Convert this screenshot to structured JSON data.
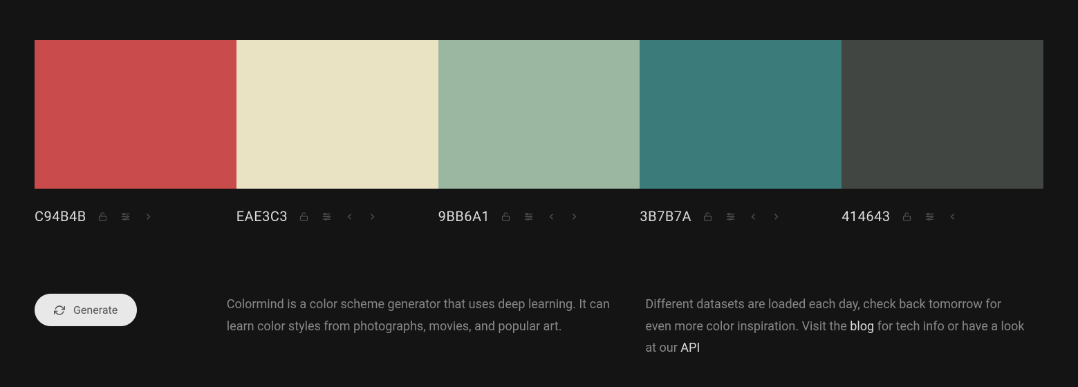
{
  "palette": {
    "swatches": [
      {
        "color": "#C94B4B",
        "hex": "C94B4B",
        "hasLeft": false,
        "hasRight": true
      },
      {
        "color": "#EAE3C3",
        "hex": "EAE3C3",
        "hasLeft": true,
        "hasRight": true
      },
      {
        "color": "#9BB6A1",
        "hex": "9BB6A1",
        "hasLeft": true,
        "hasRight": true
      },
      {
        "color": "#3B7B7A",
        "hex": "3B7B7A",
        "hasLeft": true,
        "hasRight": true
      },
      {
        "color": "#414643",
        "hex": "414643",
        "hasLeft": true,
        "hasRight": false
      }
    ]
  },
  "footer": {
    "generate_label": "Generate",
    "description": "Colormind is a color scheme generator that uses deep learning. It can learn color styles from photographs, movies, and popular art.",
    "datasets_prefix": "Different datasets are loaded each day, check back tomorrow for even more color inspiration. Visit the ",
    "blog_label": "blog",
    "datasets_mid": " for tech info or have a look at our ",
    "api_label": "API"
  }
}
